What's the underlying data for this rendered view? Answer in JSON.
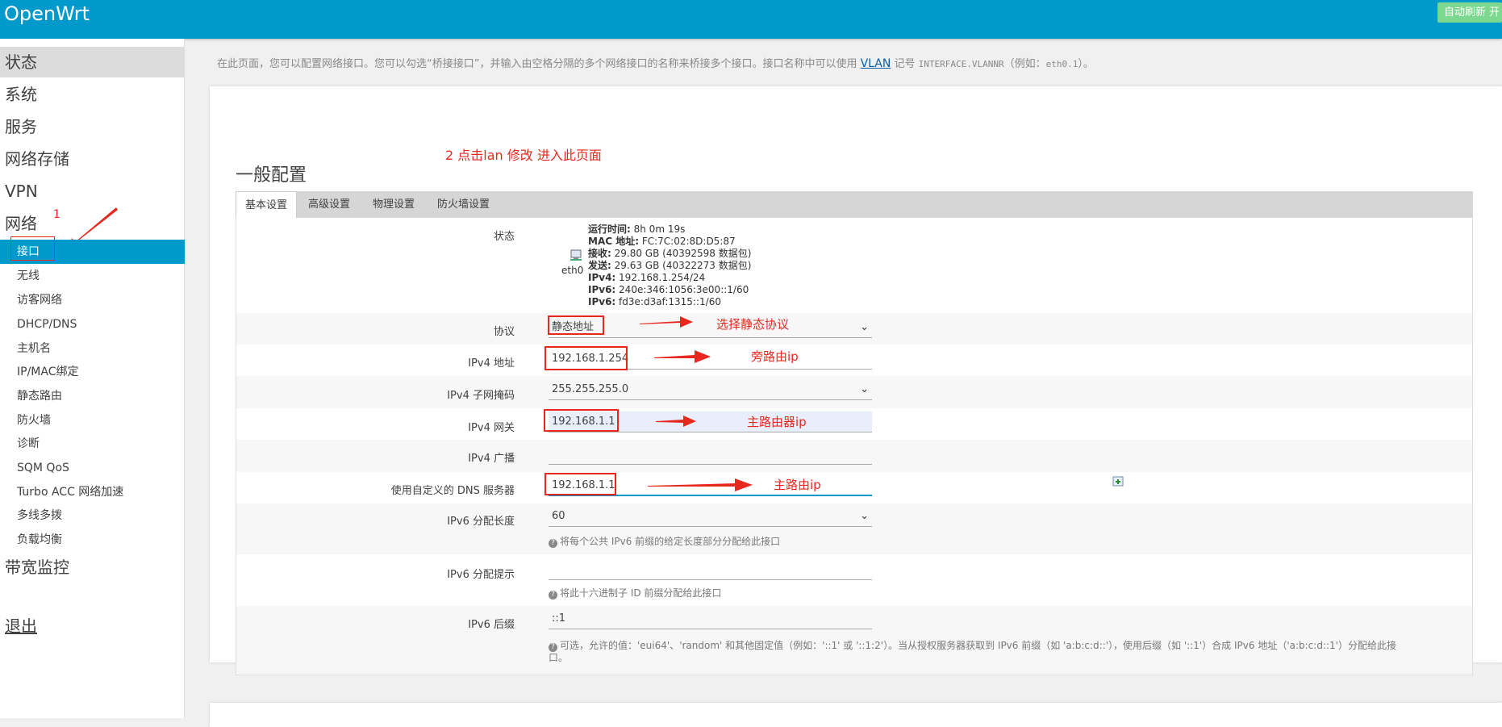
{
  "header": {
    "brand": "OpenWrt",
    "refresh_label": "自动刷新 开"
  },
  "sidebar": {
    "menus": [
      {
        "label": "状态"
      },
      {
        "label": "系统"
      },
      {
        "label": "服务"
      },
      {
        "label": "网络存储"
      },
      {
        "label": "VPN"
      },
      {
        "label": "网络"
      }
    ],
    "network_items": [
      "接口",
      "无线",
      "访客网络",
      "DHCP/DNS",
      "主机名",
      "IP/MAC绑定",
      "静态路由",
      "防火墙",
      "诊断",
      "SQM QoS",
      "Turbo ACC 网络加速",
      "多线多拨",
      "负载均衡"
    ],
    "bandwidth": "带宽监控",
    "logout": "退出",
    "annotation_1": "1"
  },
  "description": {
    "text1": "在此页面，您可以配置网络接口。您可以勾选“桥接接口”，并输入由空格分隔的多个网络接口的名称来桥接多个接口。接口名称中可以使用 ",
    "vlan": "VLAN",
    "text2": " 记号 ",
    "mono": "INTERFACE.VLANNR",
    "text3": "（例如：",
    "mono2": "eth0.1",
    "text4": "）。"
  },
  "section": {
    "title": "一般配置",
    "annotation_2": "2 点击lan 修改 进入此页面"
  },
  "tabs": [
    "基本设置",
    "高级设置",
    "物理设置",
    "防火墙设置"
  ],
  "status": {
    "label": "状态",
    "device": "eth0",
    "uptime_k": "运行时间:",
    "uptime_v": " 8h 0m 19s",
    "mac_k": "MAC 地址:",
    "mac_v": " FC:7C:02:8D:D5:87",
    "rx_k": "接收:",
    "rx_v": " 29.80 GB (40392598 数据包)",
    "tx_k": "发送:",
    "tx_v": " 29.63 GB (40322273 数据包)",
    "ipv4_k": "IPv4:",
    "ipv4_v": " 192.168.1.254/24",
    "ipv6a_k": "IPv6:",
    "ipv6a_v": " 240e:346:1056:3e00::1/60",
    "ipv6b_k": "IPv6:",
    "ipv6b_v": " fd3e:d3af:1315::1/60"
  },
  "fields": {
    "protocol": {
      "label": "协议",
      "value": "静态地址",
      "annot": "选择静态协议"
    },
    "ipv4_addr": {
      "label": "IPv4 地址",
      "value": "192.168.1.254",
      "annot": "旁路由ip"
    },
    "netmask": {
      "label": "IPv4 子网掩码",
      "value": "255.255.255.0"
    },
    "gateway": {
      "label": "IPv4 网关",
      "value": "192.168.1.1",
      "annot": "主路由器ip"
    },
    "broadcast": {
      "label": "IPv4 广播",
      "value": ""
    },
    "dns": {
      "label": "使用自定义的 DNS 服务器",
      "value": "192.168.1.1",
      "annot": "主路由ip"
    },
    "ip6assign": {
      "label": "IPv6 分配长度",
      "value": "60",
      "hint": "将每个公共 IPv6 前缀的给定长度部分分配给此接口"
    },
    "ip6hint": {
      "label": "IPv6 分配提示",
      "value": "",
      "hint": "将此十六进制子 ID 前缀分配给此接口"
    },
    "ip6suffix": {
      "label": "IPv6 后缀",
      "value": "::1",
      "hint": "可选，允许的值：'eui64'、'random' 和其他固定值（例如：'::1' 或 '::1:2'）。当从授权服务器获取到 IPv6 前缀（如 'a:b:c:d::'），使用后缀（如 '::1'）合成 IPv6 地址（'a:b:c:d::1'）分配给此接",
      "hint2": "口。"
    }
  },
  "colors": {
    "header": "#0099cc",
    "active_item": "#0099cc",
    "annotation": "#e8281e"
  }
}
